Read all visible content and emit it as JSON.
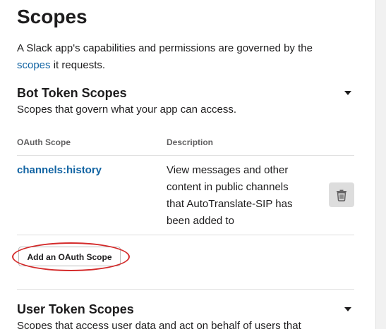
{
  "header": {
    "title": "Scopes"
  },
  "intro": {
    "text_before": "A Slack app's capabilities and permissions are governed by the",
    "link": "scopes",
    "text_after": " it requests."
  },
  "bot_section": {
    "title": "Bot Token Scopes",
    "subtitle": "Scopes that govern what your app can access.",
    "columns": {
      "scope": "OAuth Scope",
      "description": "Description"
    },
    "rows": [
      {
        "scope": "channels:history",
        "description": "View messages and other content in public channels that AutoTranslate-SIP has been added to",
        "action_icon": "trash-icon"
      }
    ],
    "add_button": "Add an OAuth Scope"
  },
  "user_section": {
    "title": "User Token Scopes",
    "subtitle": "Scopes that access user data and act on behalf of users that"
  },
  "icons": {
    "collapse": "caret-down-icon",
    "delete": "trash-icon"
  },
  "colors": {
    "link": "#1264a3",
    "annotation": "#d42b2b",
    "text": "#1d1c1d"
  }
}
